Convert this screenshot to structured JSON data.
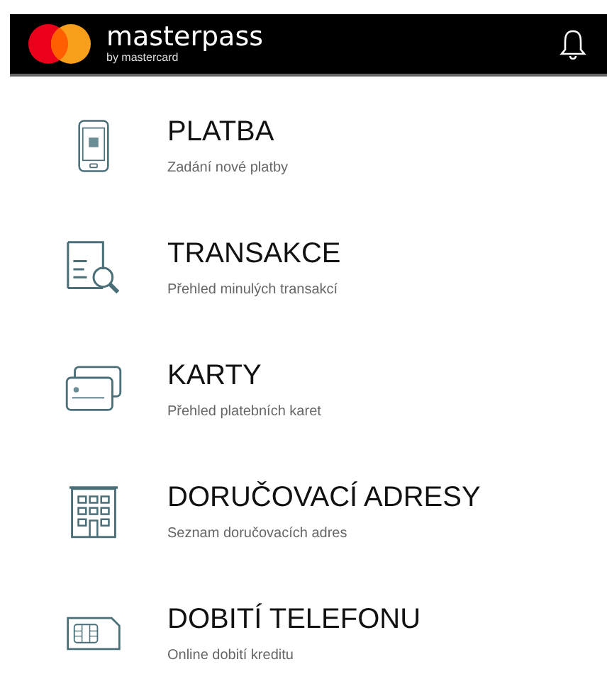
{
  "header": {
    "brand": "masterpass",
    "tagline": "by mastercard"
  },
  "menu": [
    {
      "kind": "phone",
      "title": "PLATBA",
      "subtitle": "Zadání nové platby"
    },
    {
      "kind": "document",
      "title": "TRANSAKCE",
      "subtitle": "Přehled minulých transakcí"
    },
    {
      "kind": "cards",
      "title": "KARTY",
      "subtitle": "Přehled platebních karet"
    },
    {
      "kind": "building",
      "title": "DORUČOVACÍ ADRESY",
      "subtitle": "Seznam doručovacích adres"
    },
    {
      "kind": "sim",
      "title": "DOBITÍ TELEFONU",
      "subtitle": "Online dobití kreditu"
    }
  ]
}
